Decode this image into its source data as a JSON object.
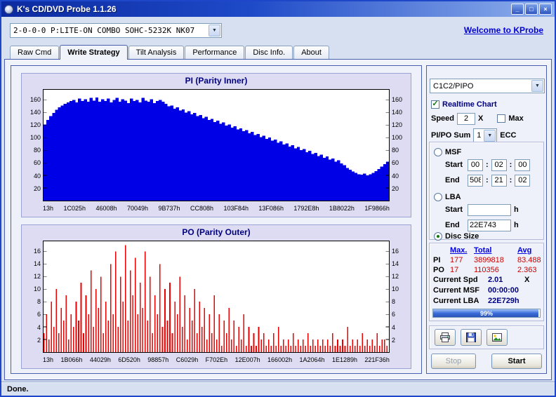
{
  "window": {
    "title": "K's CD/DVD Probe 1.1.26",
    "buttons": {
      "minimize": "_",
      "maximize": "□",
      "close": "×"
    }
  },
  "icons": {
    "dropdown": "▼",
    "check": "✓"
  },
  "toolbar": {
    "drive": "2-0-0-0 P:LITE-ON COMBO SOHC-5232K NK07",
    "link": "Welcome to KProbe"
  },
  "tabs": [
    {
      "label": "Raw Cmd",
      "active": false
    },
    {
      "label": "Write Strategy",
      "active": true
    },
    {
      "label": "Tilt Analysis",
      "active": false
    },
    {
      "label": "Performance",
      "active": false
    },
    {
      "label": "Disc Info.",
      "active": false
    },
    {
      "label": "About",
      "active": false
    }
  ],
  "right_panel": {
    "mode_combo": "C1C2/PIPO",
    "realtime_chart_label": "Realtime Chart",
    "speed_label": "Speed",
    "speed_value": "2",
    "speed_unit": "X",
    "max_label": "Max",
    "pipo_sum_label": "PI/PO Sum",
    "pipo_sum_value": "1",
    "ecc_label": "ECC",
    "sep": ":",
    "msf": {
      "label": "MSF",
      "start_label": "Start",
      "end_label": "End",
      "start": [
        "00",
        "02",
        "00"
      ],
      "end": [
        "508",
        "21",
        "02"
      ]
    },
    "lba": {
      "label": "LBA",
      "start_label": "Start",
      "end_label": "End",
      "start": "",
      "end": "22E743",
      "unit": "h"
    },
    "disc_size_label": "Disc Size",
    "stats": {
      "headers": [
        "Max.",
        "Total",
        "Avg"
      ],
      "rows": [
        {
          "label": "PI",
          "max": "177",
          "total": "3899818",
          "avg": "83.488"
        },
        {
          "label": "PO",
          "max": "17",
          "total": "110356",
          "avg": "2.363"
        }
      ]
    },
    "current": [
      {
        "label": "Current Spd",
        "value": "2.01",
        "suffix": "X"
      },
      {
        "label": "Current MSF",
        "value": "00:00:00",
        "suffix": ""
      },
      {
        "label": "Current LBA",
        "value": "22E729h",
        "suffix": ""
      }
    ],
    "progress": "99%",
    "stop_label": "Stop",
    "start_label": "Start"
  },
  "statusbar": {
    "text": "Done."
  },
  "chart_data": [
    {
      "type": "bar",
      "key": "pi",
      "title": "PI (Parity Inner)",
      "color": "#0000e6",
      "xlabel": "",
      "ylabel": "",
      "ylim": [
        0,
        176
      ],
      "yticks": [
        20,
        40,
        60,
        80,
        100,
        120,
        140,
        160
      ],
      "grid": false,
      "legend": "none",
      "solid": true,
      "xticklabels": [
        "13h",
        "1C025h",
        "46008h",
        "70049h",
        "9B737h",
        "CC808h",
        "103F84h",
        "13F086h",
        "1792E8h",
        "1B8022h",
        "1F9866h"
      ],
      "values": [
        121,
        128,
        134,
        139,
        144,
        148,
        151,
        154,
        156,
        158,
        160,
        156,
        162,
        158,
        161,
        157,
        163,
        159,
        164,
        157,
        161,
        158,
        162,
        156,
        160,
        163,
        157,
        161,
        159,
        155,
        162,
        158,
        160,
        156,
        163,
        159,
        157,
        161,
        155,
        158,
        160,
        157,
        154,
        150,
        151,
        146,
        148,
        143,
        145,
        140,
        142,
        137,
        139,
        134,
        136,
        131,
        133,
        128,
        130,
        125,
        127,
        122,
        124,
        119,
        121,
        116,
        118,
        113,
        115,
        110,
        112,
        107,
        109,
        104,
        106,
        101,
        103,
        98,
        100,
        95,
        97,
        92,
        94,
        89,
        91,
        86,
        88,
        83,
        85,
        80,
        82,
        77,
        79,
        74,
        76,
        71,
        73,
        68,
        70,
        65,
        67,
        62,
        64,
        59,
        56,
        52,
        49,
        46,
        44,
        42,
        41,
        43,
        40,
        42,
        44,
        47,
        50,
        54,
        58,
        62
      ]
    },
    {
      "type": "bar",
      "key": "po",
      "title": "PO (Parity Outer)",
      "color": "#ee0000",
      "xlabel": "",
      "ylabel": "",
      "ylim": [
        0,
        17.6
      ],
      "yticks": [
        2,
        4,
        6,
        8,
        10,
        12,
        14,
        16
      ],
      "grid": false,
      "legend": "none",
      "solid": false,
      "xticklabels": [
        "13h",
        "1B066h",
        "44029h",
        "6D520h",
        "98857h",
        "C6029h",
        "F702Eh",
        "12E007h",
        "166002h",
        "1A2064h",
        "1E1289h",
        "221F36h"
      ],
      "values": [
        3,
        6,
        2,
        8,
        4,
        10,
        3,
        7,
        5,
        9,
        2,
        6,
        4,
        8,
        5,
        11,
        3,
        9,
        6,
        13,
        4,
        10,
        7,
        12,
        3,
        8,
        5,
        14,
        6,
        16,
        4,
        12,
        8,
        17,
        5,
        13,
        9,
        15,
        6,
        11,
        7,
        16,
        5,
        12,
        3,
        9,
        6,
        14,
        4,
        10,
        5,
        11,
        3,
        8,
        6,
        12,
        4,
        9,
        2,
        7,
        5,
        10,
        3,
        8,
        4,
        7,
        2,
        6,
        3,
        9,
        2,
        6,
        1,
        5,
        3,
        7,
        2,
        5,
        1,
        4,
        2,
        6,
        1,
        4,
        1,
        3,
        1,
        4,
        2,
        3,
        1,
        2,
        1,
        3,
        1,
        4,
        1,
        2,
        1,
        2,
        1,
        3,
        1,
        2,
        1,
        2,
        1,
        3,
        1,
        2,
        1,
        2,
        1,
        2,
        1,
        2,
        1,
        3,
        1,
        2,
        1,
        2,
        1,
        4,
        1,
        2,
        1,
        2,
        1,
        3,
        1,
        2,
        1,
        2,
        1,
        3,
        1,
        2,
        2,
        1
      ]
    }
  ]
}
